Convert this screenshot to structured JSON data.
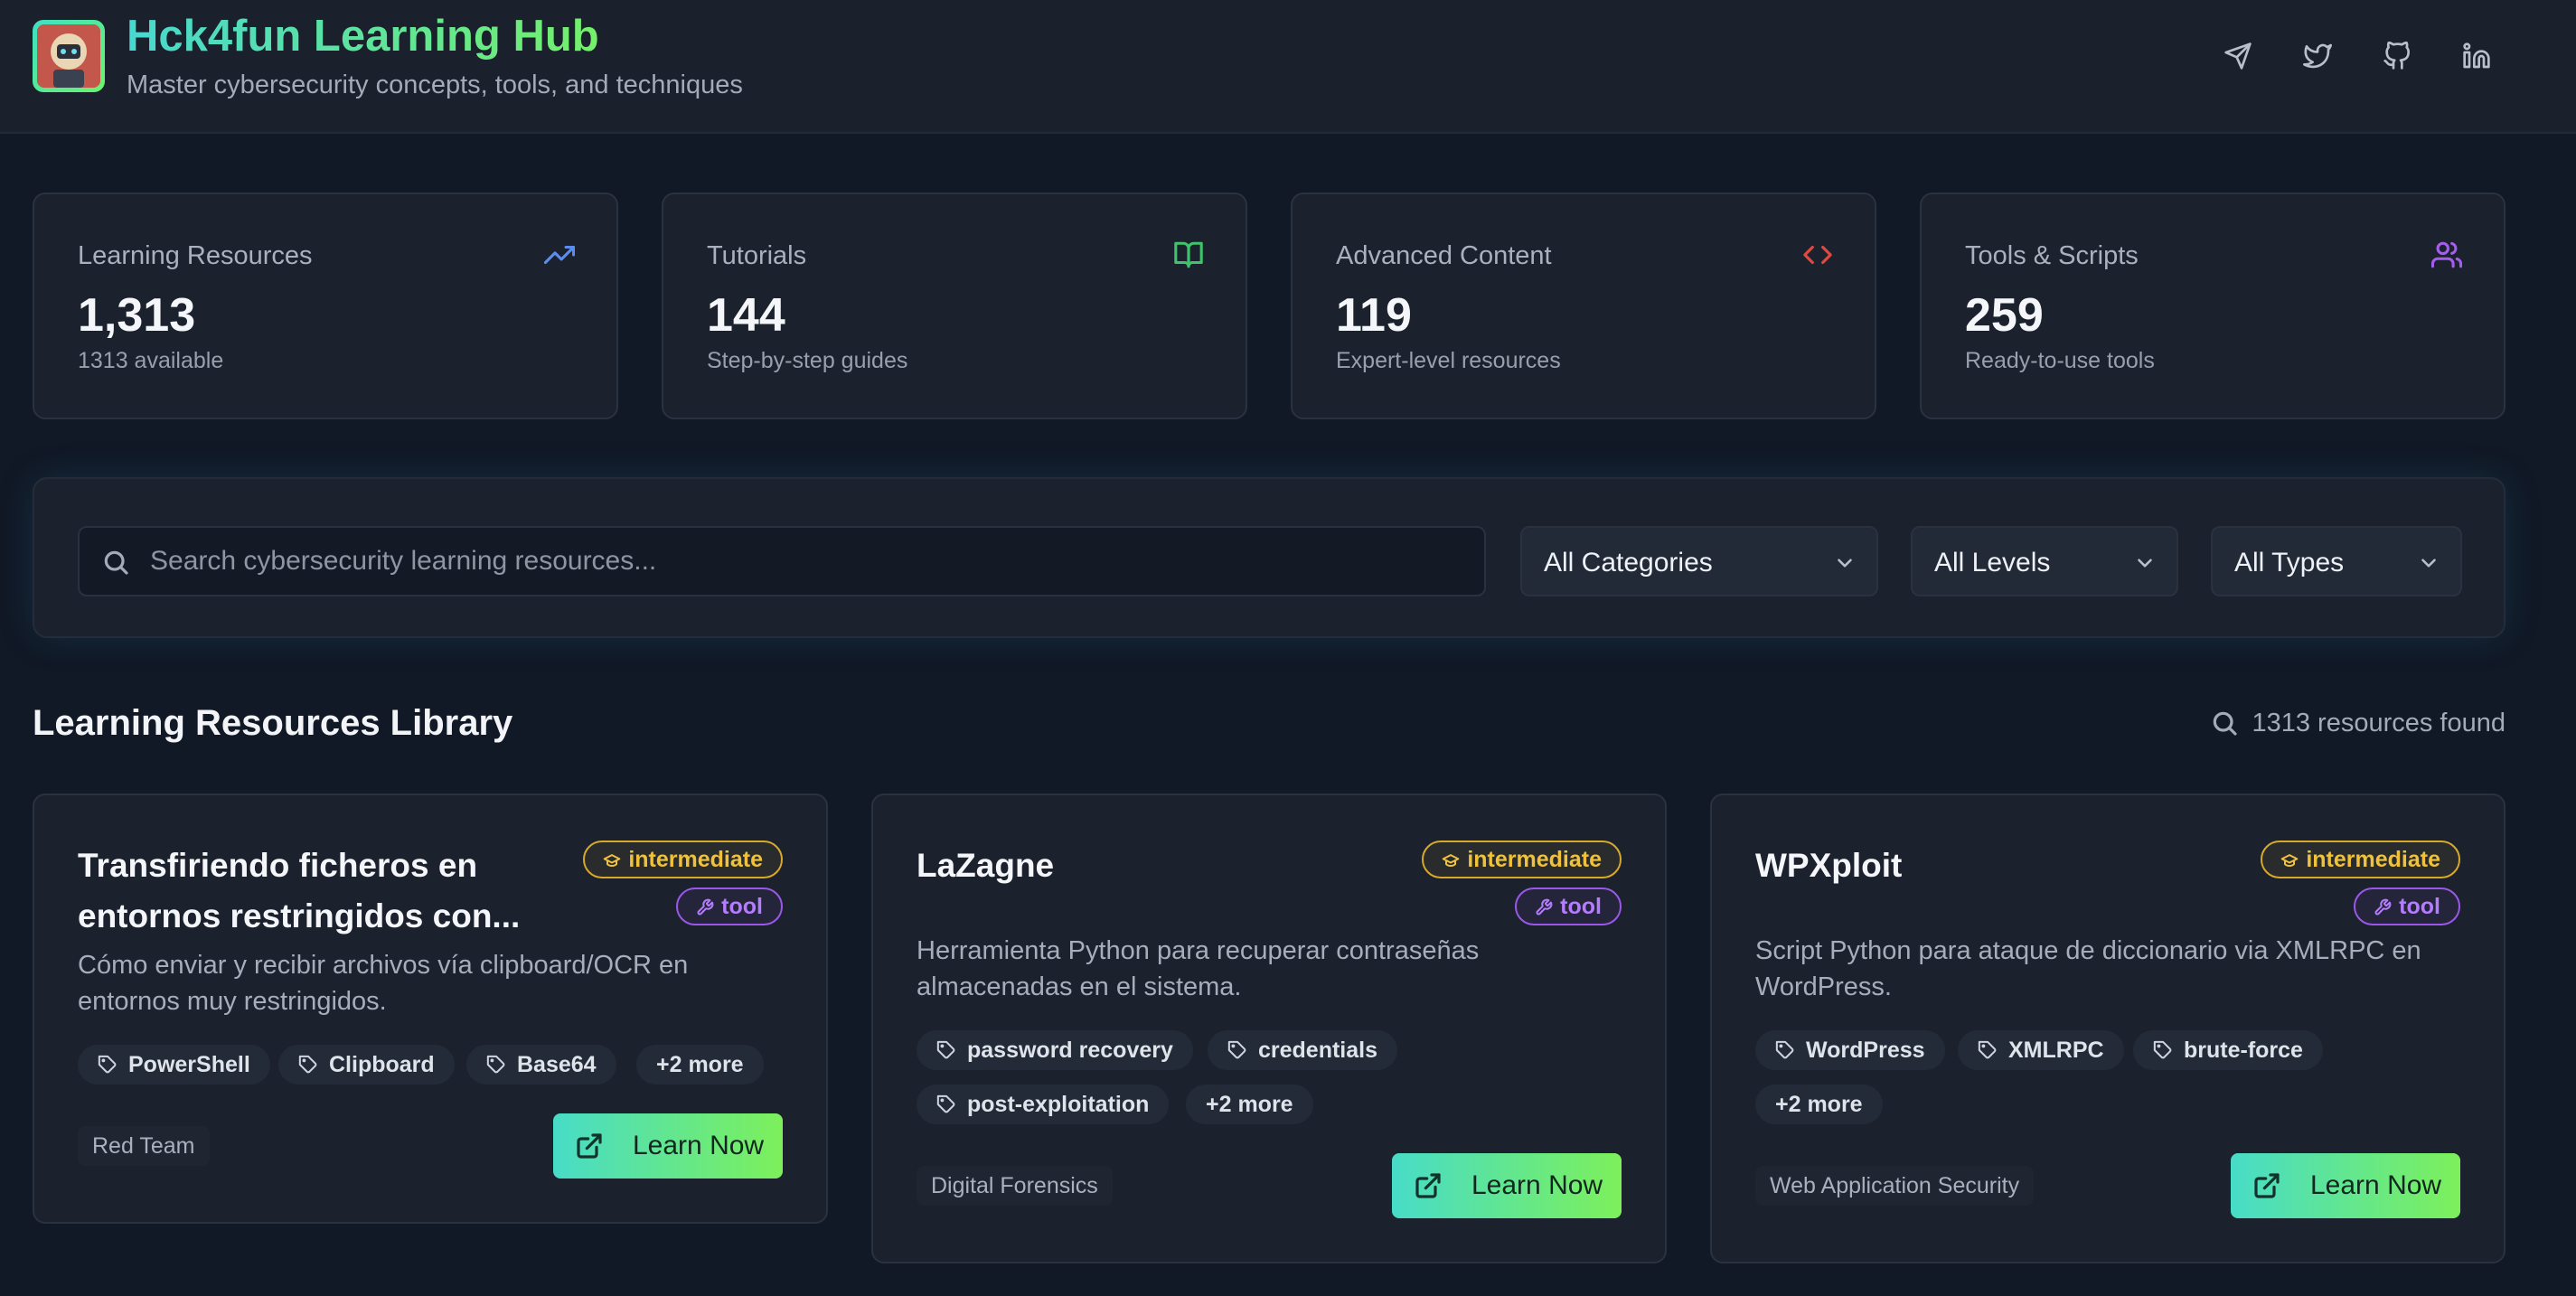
{
  "header": {
    "title": "Hck4fun Learning Hub",
    "subtitle": "Master cybersecurity concepts, tools, and techniques",
    "social": [
      "telegram-icon",
      "twitter-icon",
      "github-icon",
      "linkedin-icon"
    ]
  },
  "stats": [
    {
      "label": "Learning Resources",
      "value": "1,313",
      "sub": "1313 available",
      "icon": "trending-up-icon",
      "color": "#5b8def"
    },
    {
      "label": "Tutorials",
      "value": "144",
      "sub": "Step-by-step guides",
      "icon": "book-open-icon",
      "color": "#3fc46b"
    },
    {
      "label": "Advanced Content",
      "value": "119",
      "sub": "Expert-level resources",
      "icon": "code-icon",
      "color": "#e0493f"
    },
    {
      "label": "Tools & Scripts",
      "value": "259",
      "sub": "Ready-to-use tools",
      "icon": "users-icon",
      "color": "#a55cf0"
    }
  ],
  "filters": {
    "search_placeholder": "Search cybersecurity learning resources...",
    "search_value": "",
    "category": "All Categories",
    "level": "All Levels",
    "type": "All Types"
  },
  "library": {
    "title": "Learning Resources Library",
    "results": "1313 resources found"
  },
  "cards": [
    {
      "title": "Transfiriendo ficheros en entornos restringidos con...",
      "description": "Cómo enviar y recibir archivos vía clipboard/OCR en entornos muy restringidos.",
      "level": "intermediate",
      "type": "tool",
      "tags": [
        "PowerShell",
        "Clipboard",
        "Base64"
      ],
      "more": "+2 more",
      "category": "Red Team",
      "button": "Learn Now"
    },
    {
      "title": "LaZagne",
      "description": "Herramienta Python para recuperar contraseñas almacenadas en el sistema.",
      "level": "intermediate",
      "type": "tool",
      "tags": [
        "password recovery",
        "credentials",
        "post-exploitation"
      ],
      "more": "+2 more",
      "category": "Digital Forensics",
      "button": "Learn Now"
    },
    {
      "title": "WPXploit",
      "description": "Script Python para ataque de diccionario via XMLRPC en WordPress.",
      "level": "intermediate",
      "type": "tool",
      "tags": [
        "WordPress",
        "XMLRPC",
        "brute-force"
      ],
      "more": "+2 more",
      "category": "Web Application Security",
      "button": "Learn Now"
    }
  ]
}
